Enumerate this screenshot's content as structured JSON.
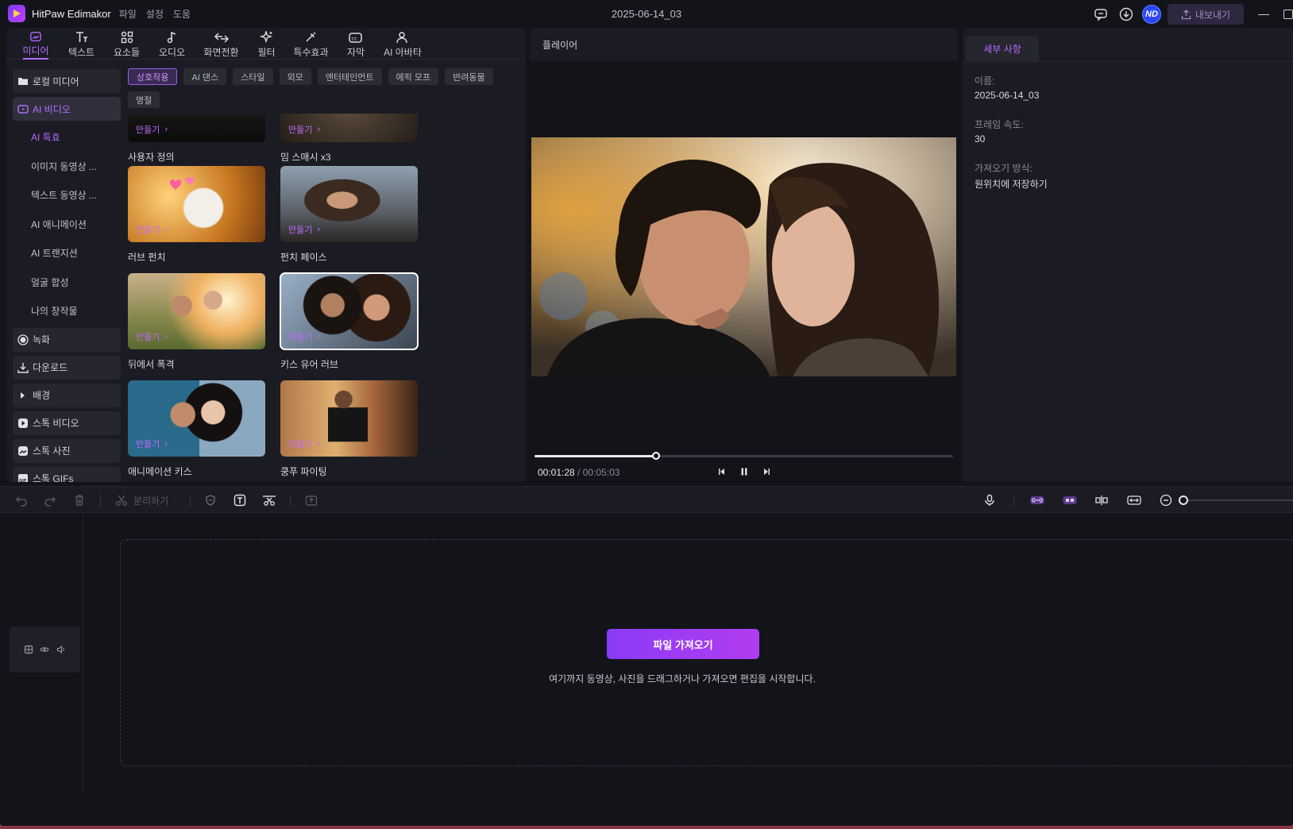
{
  "app": {
    "name": "HitPaw Edimakor",
    "menu": [
      "파일",
      "설정",
      "도움"
    ],
    "document_title": "2025-06-14_03",
    "avatar_initials": "ND",
    "export_label": "내보내기"
  },
  "tool_tabs": [
    {
      "label": "미디어",
      "icon": "media-icon",
      "active": true
    },
    {
      "label": "텍스트",
      "icon": "text-icon"
    },
    {
      "label": "요소들",
      "icon": "elements-icon"
    },
    {
      "label": "오디오",
      "icon": "audio-icon"
    },
    {
      "label": "화면전환",
      "icon": "transition-icon"
    },
    {
      "label": "필터",
      "icon": "filter-icon"
    },
    {
      "label": "특수효과",
      "icon": "effects-icon"
    },
    {
      "label": "자막",
      "icon": "subtitle-icon"
    },
    {
      "label": "AI 아바타",
      "icon": "avatar-icon"
    }
  ],
  "sidebar": {
    "local_media": "로컬 미디어",
    "ai_video": "AI 비디오",
    "sub_items": [
      "AI 특효",
      "이미지 동영상 ...",
      "텍스트 동영상 ...",
      "AI 애니메이션",
      "AI 트랜지션",
      "얼굴 합성",
      "나의 창작물"
    ],
    "items": [
      "녹화",
      "다운로드",
      "배경",
      "스톡 비디오",
      "스톡 사진",
      "스톡 GIFs"
    ]
  },
  "categories": [
    "상호작용",
    "AI 댄스",
    "스타일",
    "외모",
    "엔터테인먼트",
    "에픽 모프",
    "반려동물",
    "명절"
  ],
  "cards": {
    "make_label": "만들기",
    "items": [
      "사용자 정의",
      "밈 스매시 x3",
      "러브 펀치",
      "펀치 페이스",
      "뒤에서 폭격",
      "키스 유어 러브",
      "애니메이션 키스",
      "쿵푸 파이팅"
    ]
  },
  "player": {
    "title": "플레이어",
    "current_time": "00:01:28",
    "separator": " / ",
    "total_time": "00:05:03",
    "progress": 0.29
  },
  "details": {
    "tab": "세부 사항",
    "name_label": "이름:",
    "name_value": "2025-06-14_03",
    "fps_label": "프레임 속도:",
    "fps_value": "30",
    "import_label": "가져오기 방식:",
    "import_value": "원위치에 저장하기"
  },
  "toolbar": {
    "split_label": "분리하기"
  },
  "timeline": {
    "import_button": "파일 가져오기",
    "hint": "여기까지 동영상, 사진을 드래그하거나 가져오면 편집을 시작합니다."
  },
  "colors": {
    "accent": "#b66bff",
    "background": "#131419",
    "panel": "#1b1c23"
  }
}
